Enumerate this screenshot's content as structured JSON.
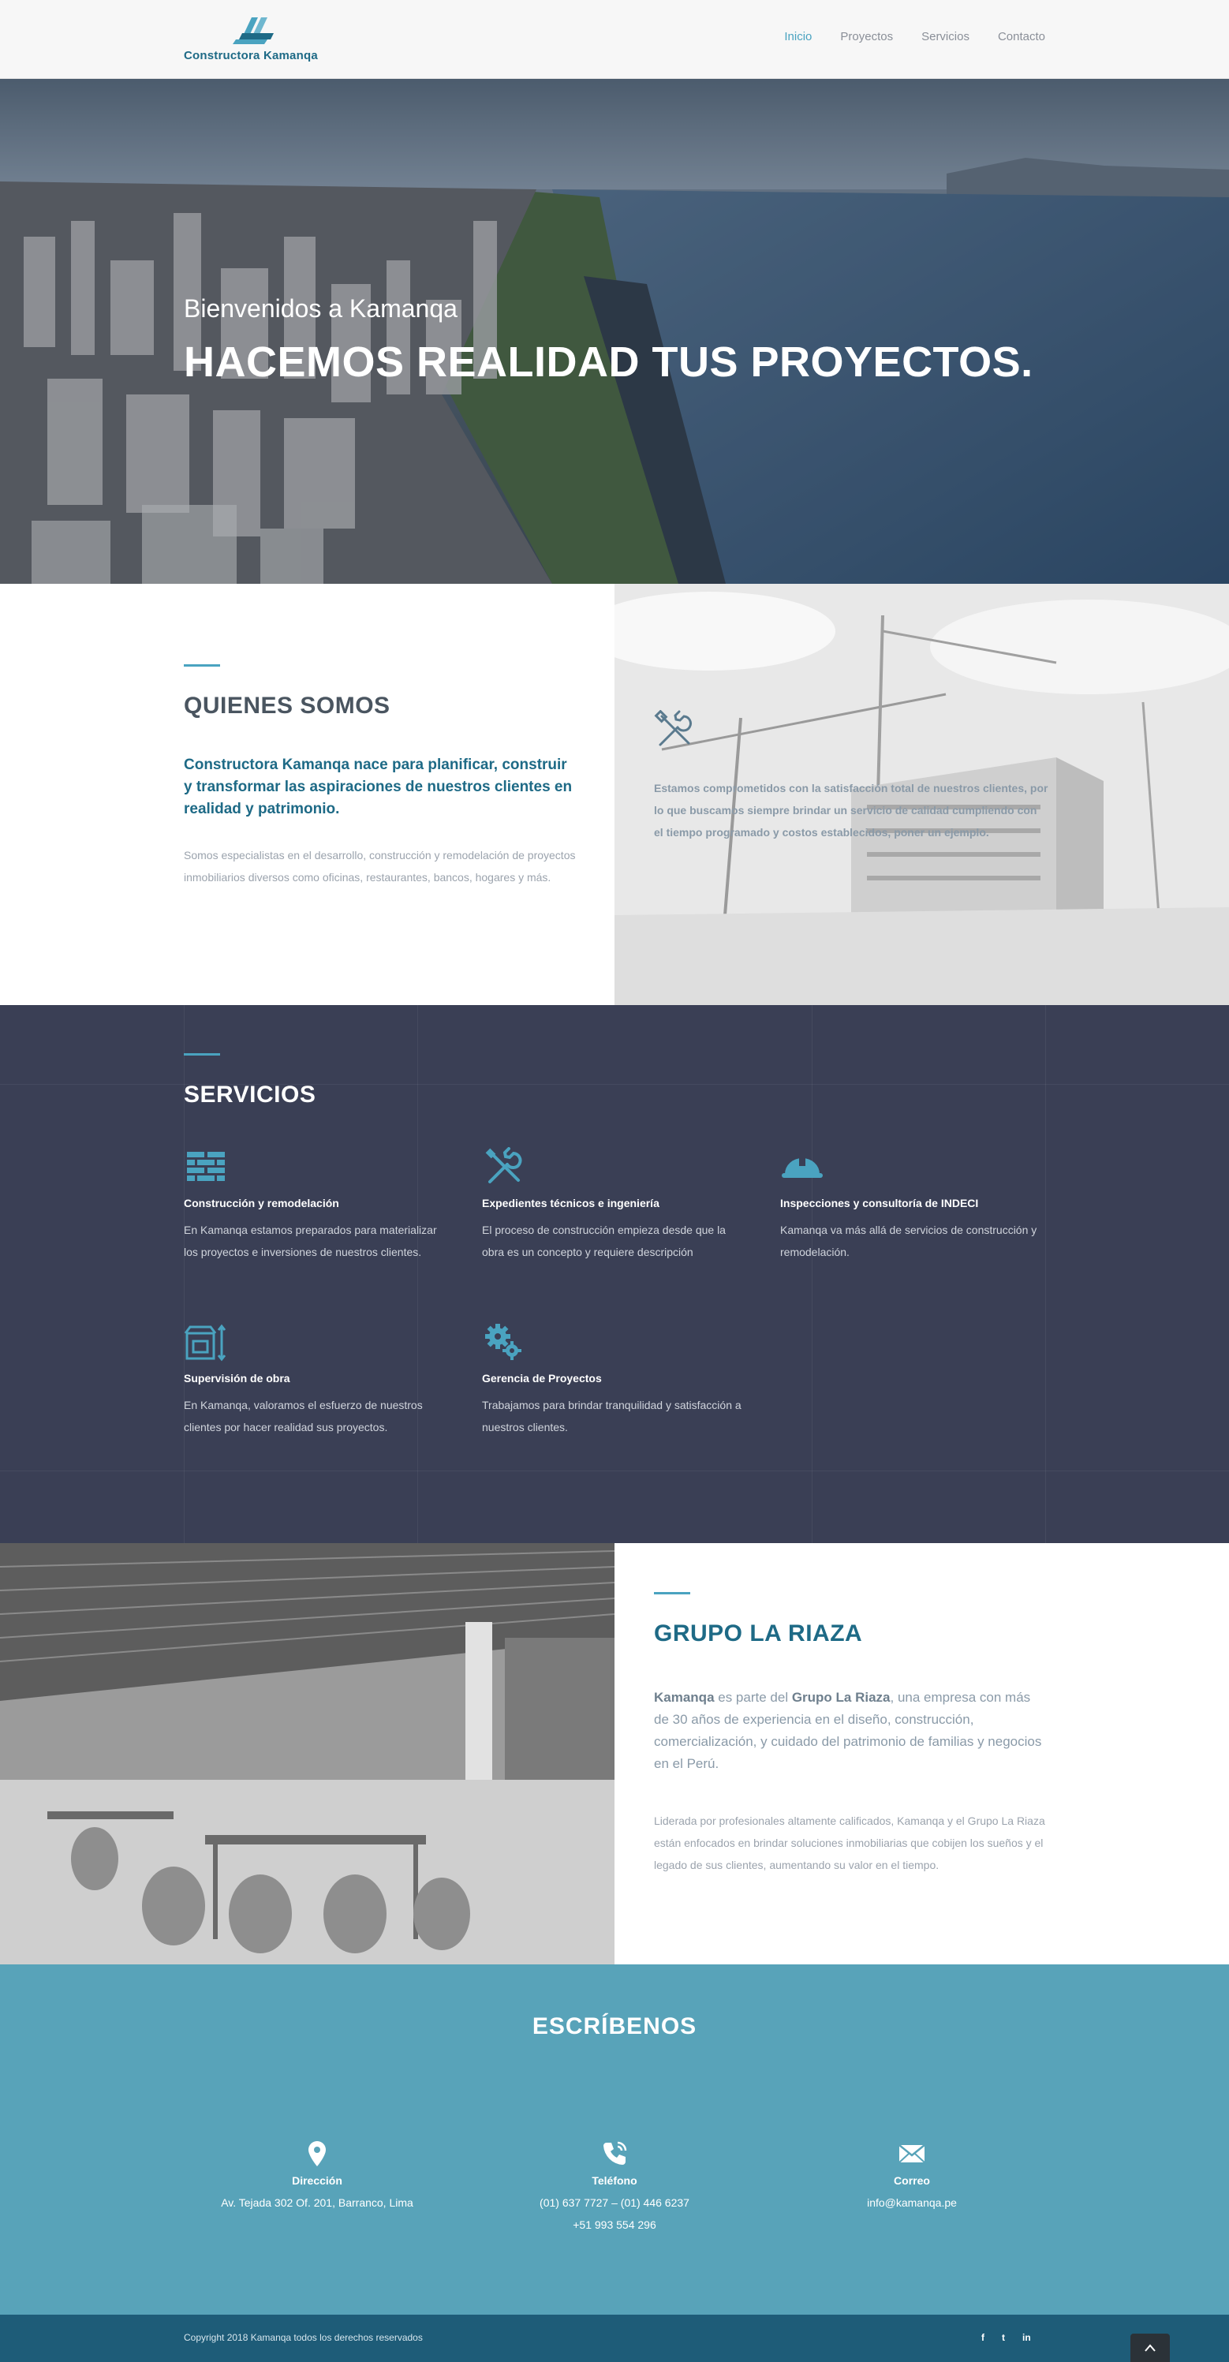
{
  "header": {
    "logo_text": "Constructora Kamanqa",
    "nav": [
      {
        "label": "Inicio"
      },
      {
        "label": "Proyectos"
      },
      {
        "label": "Servicios"
      },
      {
        "label": "Contacto"
      }
    ]
  },
  "hero": {
    "subtitle": "Bienvenidos a Kamanqa",
    "title": "HACEMOS REALIDAD TUS PROYECTOS."
  },
  "about": {
    "title": "QUIENES SOMOS",
    "lead": "Constructora Kamanqa nace para planificar, construir y transformar las aspiraciones de nuestros clientes en realidad y patrimonio.",
    "body": "Somos especialistas en el desarrollo, construcción y remodelación de proyectos inmobiliarios diversos como oficinas, restaurantes, bancos, hogares y más.",
    "right_icon": "tools-icon",
    "right_text": "Estamos comprometidos con la satisfacción total de nuestros clientes, por lo que buscamos siempre brindar un servicio de calidad cumpliendo con el tiempo programado y costos establecidos, poner un ejemplo."
  },
  "services": {
    "title": "SERVICIOS",
    "items": [
      {
        "icon": "bricks-icon",
        "title": "Construcción y remodelación",
        "desc": "En Kamanqa estamos preparados para materializar los proyectos e inversiones de nuestros clientes."
      },
      {
        "icon": "tools-icon",
        "title": "Expedientes técnicos e ingeniería",
        "desc": "El proceso de construcción empieza desde que la obra es un concepto y requiere descripción"
      },
      {
        "icon": "helmet-icon",
        "title": "Inspecciones y consultoría de INDECI",
        "desc": "Kamanqa va más allá de servicios de construcción y remodelación."
      },
      {
        "icon": "building-supervision-icon",
        "title": "Supervisión de obra",
        "desc": "En Kamanqa, valoramos el esfuerzo de nuestros clientes por hacer realidad sus proyectos."
      },
      {
        "icon": "gears-icon",
        "title": "Gerencia de Proyectos",
        "desc": "Trabajamos para brindar tranquilidad y satisfacción a nuestros clientes."
      }
    ]
  },
  "grupo": {
    "title": "GRUPO LA RIAZA",
    "lead_part1": "Kamanqa",
    "lead_part2": " es parte del ",
    "lead_part3": "Grupo La Riaza",
    "lead_part4": ", una empresa con más de 30 años de experiencia en el diseño, construcción, comercialización, y cuidado del patrimonio de familias y negocios en el Perú.",
    "body": "Liderada por profesionales altamente calificados, Kamanqa y el Grupo La Riaza están enfocados en brindar soluciones inmobiliarias que cobijen los sueños y el legado de sus clientes, aumentando su valor en el tiempo."
  },
  "contact": {
    "title": "ESCRÍBENOS",
    "columns": [
      {
        "icon": "map-pin-icon",
        "label": "Dirección",
        "lines": [
          "Av. Tejada 302 Of. 201, Barranco, Lima"
        ]
      },
      {
        "icon": "phone-icon",
        "label": "Teléfono",
        "lines": [
          "(01) 637 7727 – (01) 446 6237",
          "+51 993 554 296"
        ]
      },
      {
        "icon": "envelope-icon",
        "label": "Correo",
        "lines": [
          "info@kamanqa.pe"
        ]
      }
    ]
  },
  "footer": {
    "copyright": "Copyright 2018 Kamanqa todos los derechos reservados",
    "socials": [
      "f",
      "t",
      "in"
    ]
  },
  "colors": {
    "brand": "#1e6a86",
    "accent": "#4aa3c0",
    "services_bg": "#3a3f55",
    "contact_bg": "#58a3b9",
    "footer_bg": "#1e5c78"
  }
}
